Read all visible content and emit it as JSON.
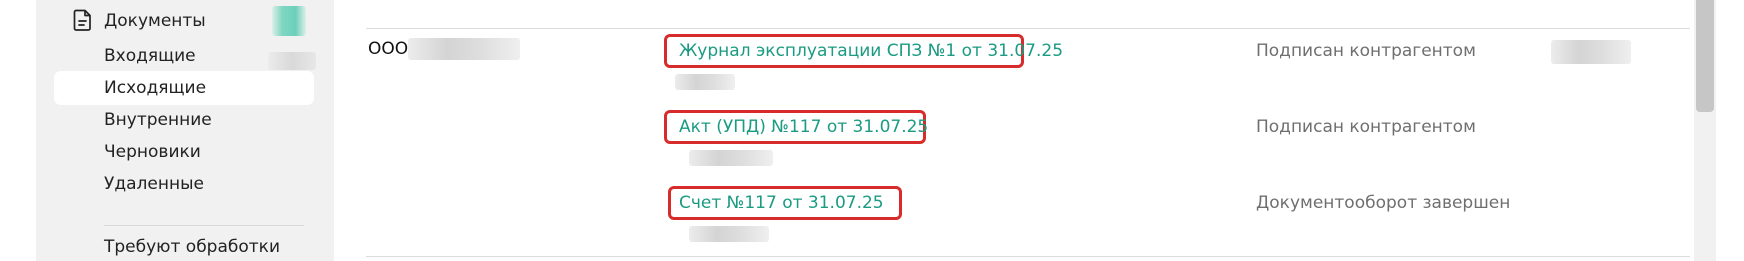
{
  "sidebar": {
    "header_label": "Документы",
    "items": [
      {
        "label": "Входящие"
      },
      {
        "label": "Исходящие"
      },
      {
        "label": "Внутренние"
      },
      {
        "label": "Черновики"
      },
      {
        "label": "Удаленные"
      },
      {
        "label": "Требуют обработки"
      }
    ],
    "active_item": "Исходящие"
  },
  "icons": {
    "header": "document-icon"
  },
  "colors": {
    "link": "#1a9b82",
    "highlight_border": "#d82b2b",
    "sidebar_bg": "#f1f1f1",
    "status_text": "#6f6f6f"
  },
  "table": {
    "counterparty": "ООО",
    "rows": [
      {
        "document": "Журнал эксплуатации СПЗ №1 от 31.07.25",
        "status": "Подписан контрагентом"
      },
      {
        "document": "Акт (УПД) №117 от 31.07.25",
        "status": "Подписан контрагентом"
      },
      {
        "document": "Счет №117 от 31.07.25",
        "status": "Документооборот завершен"
      }
    ]
  }
}
